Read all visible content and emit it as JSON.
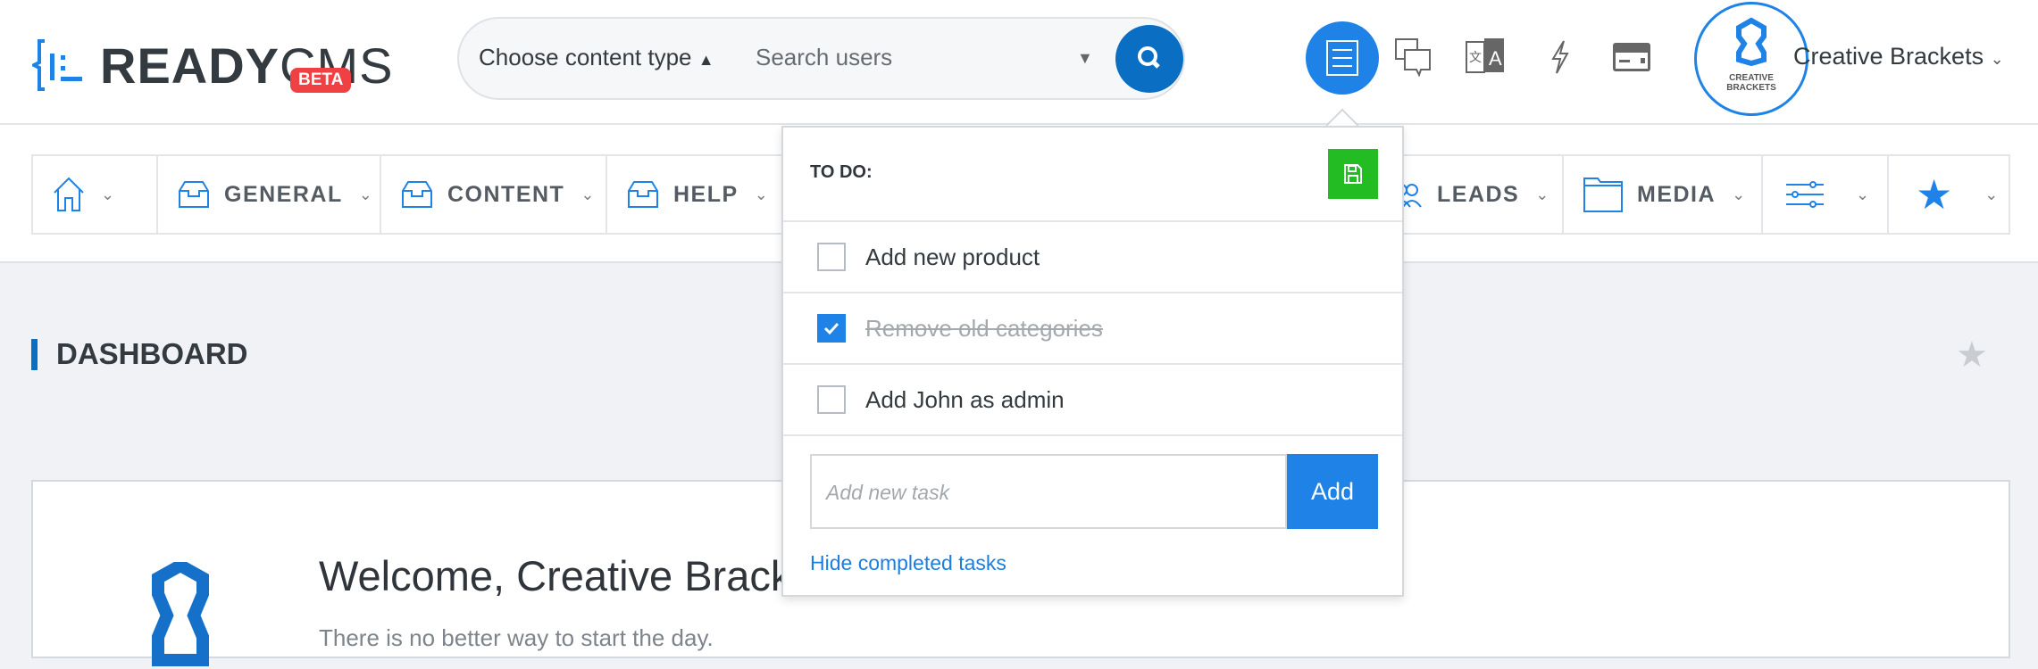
{
  "header": {
    "logo": {
      "ready": "READY",
      "cms": "CMS",
      "badge": "BETA"
    },
    "search": {
      "content_type": "Choose content type",
      "placeholder": "Search users"
    },
    "icons": [
      "todo-list-icon",
      "chat-icon",
      "translate-icon",
      "bolt-icon",
      "credit-card-icon"
    ],
    "avatar_text": "CREATIVE BRACKETS",
    "user_name": "Creative Brackets"
  },
  "nav": {
    "items": [
      {
        "icon": "home-icon",
        "label": ""
      },
      {
        "icon": "inbox-icon",
        "label": "GENERAL"
      },
      {
        "icon": "inbox-icon",
        "label": "CONTENT"
      },
      {
        "icon": "inbox-icon",
        "label": "HELP"
      },
      {
        "icon": "users-icon",
        "label": "LEADS"
      },
      {
        "icon": "folder-icon",
        "label": "MEDIA"
      },
      {
        "icon": "sliders-icon",
        "label": ""
      },
      {
        "icon": "star-icon",
        "label": ""
      }
    ]
  },
  "page": {
    "title": "DASHBOARD",
    "welcome": "Welcome, Creative Brackets",
    "subtitle": "There is no better way to start the day."
  },
  "todo": {
    "title": "TO DO:",
    "tasks": [
      {
        "label": "Add new product",
        "done": false
      },
      {
        "label": "Remove old categories",
        "done": true
      },
      {
        "label": "Add John as admin",
        "done": false
      }
    ],
    "input_placeholder": "Add new task",
    "add_label": "Add",
    "hide_link": "Hide completed tasks"
  },
  "colors": {
    "accent": "#1e82e6",
    "save": "#23bc23",
    "beta": "#ef4044",
    "link": "#1a7fe0"
  }
}
